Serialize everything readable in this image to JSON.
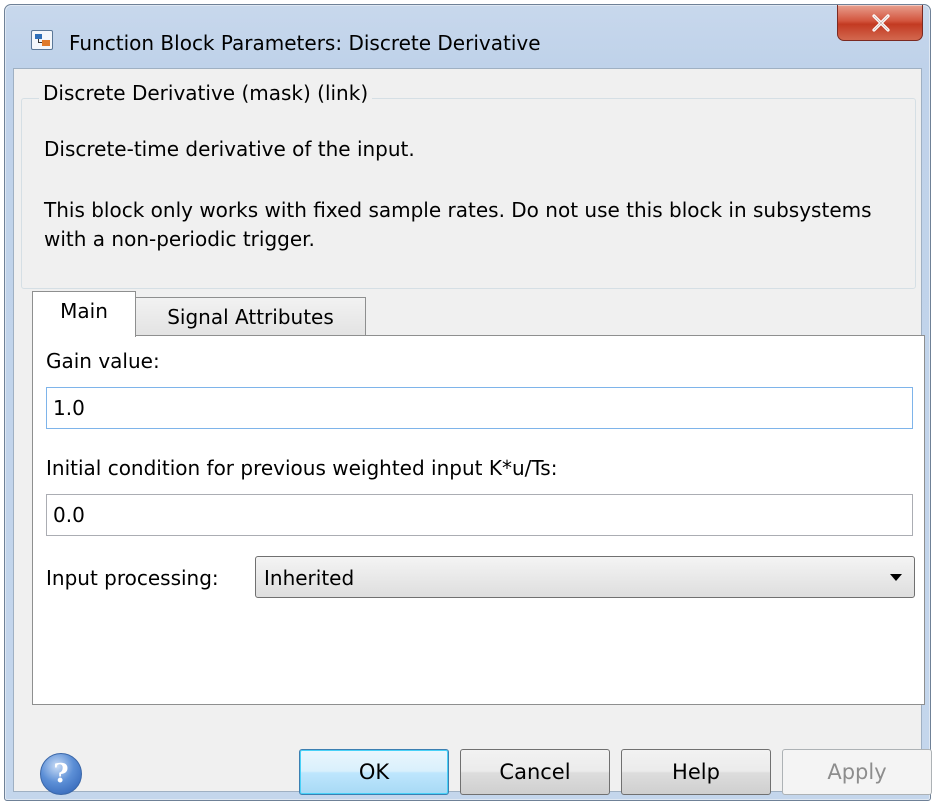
{
  "window": {
    "title": "Function Block Parameters: Discrete Derivative"
  },
  "description": {
    "legend": "Discrete Derivative (mask) (link)",
    "line1": "Discrete-time derivative of the input.",
    "line2": "This block only works with fixed sample rates. Do not use this block in subsystems with a non-periodic trigger."
  },
  "tabs": [
    {
      "label": "Main",
      "selected": true
    },
    {
      "label": "Signal Attributes",
      "selected": false
    }
  ],
  "main": {
    "gain_label": "Gain value:",
    "gain_value": "1.0",
    "initial_label": "Initial condition for previous weighted input K*u/Ts:",
    "initial_value": "0.0",
    "input_processing_label": "Input processing:",
    "input_processing_value": "Inherited"
  },
  "buttons": {
    "ok": "OK",
    "cancel": "Cancel",
    "help": "Help",
    "apply": "Apply",
    "help_icon": "?"
  },
  "icons": {
    "app": "simulink-block-icon",
    "close": "close-icon",
    "help": "help-circle-icon",
    "dropdown": "chevron-down-icon"
  },
  "colors": {
    "close_button": "#c33a22",
    "ok_border": "#3c7fb1",
    "disabled_text": "#8d8d8d"
  }
}
